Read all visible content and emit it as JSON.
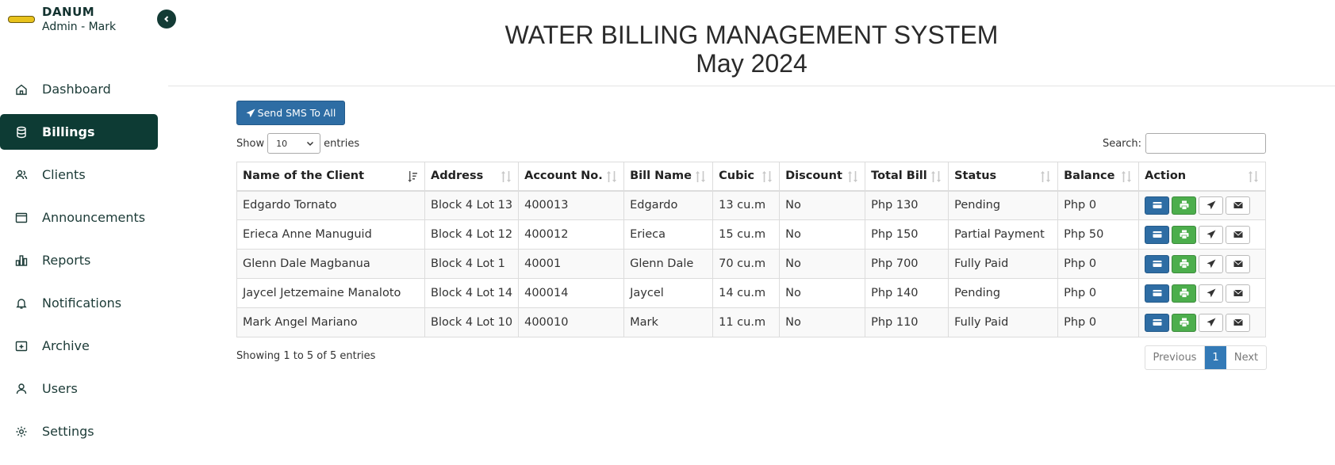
{
  "sidebar": {
    "brand": "DANUM",
    "user": "Admin - Mark",
    "items": [
      {
        "label": "Dashboard",
        "icon": "home-icon"
      },
      {
        "label": "Billings",
        "icon": "database-icon",
        "active": true
      },
      {
        "label": "Clients",
        "icon": "users-icon"
      },
      {
        "label": "Announcements",
        "icon": "window-icon"
      },
      {
        "label": "Reports",
        "icon": "bar-chart-icon"
      },
      {
        "label": "Notifications",
        "icon": "bell-icon"
      },
      {
        "label": "Archive",
        "icon": "archive-icon"
      },
      {
        "label": "Users",
        "icon": "user-icon"
      },
      {
        "label": "Settings",
        "icon": "gear-icon"
      }
    ]
  },
  "header": {
    "title": "WATER BILLING MANAGEMENT SYSTEM",
    "period": "May 2024"
  },
  "toolbar": {
    "sms_all_label": "Send SMS To All",
    "show_label": "Show",
    "entries_value": "10",
    "entries_label": "entries",
    "search_label": "Search:"
  },
  "table": {
    "columns": [
      "Name of the Client",
      "Address",
      "Account No.",
      "Bill Name",
      "Cubic",
      "Discount",
      "Total Bill",
      "Status",
      "Balance",
      "Action"
    ],
    "rows": [
      [
        "Edgardo Tornato",
        "Block 4 Lot 13",
        "400013",
        "Edgardo",
        "13 cu.m",
        "No",
        "Php 130",
        "Pending",
        "Php 0"
      ],
      [
        "Erieca Anne Manuguid",
        "Block 4 Lot 12",
        "400012",
        "Erieca",
        "15 cu.m",
        "No",
        "Php 150",
        "Partial Payment",
        "Php 50"
      ],
      [
        "Glenn Dale Magbanua",
        "Block 4 Lot 1",
        "40001",
        "Glenn Dale",
        "70 cu.m",
        "No",
        "Php 700",
        "Fully Paid",
        "Php 0"
      ],
      [
        "Jaycel Jetzemaine Manaloto",
        "Block 4 Lot 14",
        "400014",
        "Jaycel",
        "14 cu.m",
        "No",
        "Php 140",
        "Pending",
        "Php 0"
      ],
      [
        "Mark Angel Mariano",
        "Block 4 Lot 10",
        "400010",
        "Mark",
        "11 cu.m",
        "No",
        "Php 110",
        "Fully Paid",
        "Php 0"
      ]
    ]
  },
  "footer": {
    "info": "Showing 1 to 5 of 5 entries",
    "prev": "Previous",
    "page": "1",
    "next": "Next"
  },
  "colors": {
    "sidebar_active": "#0d3b34",
    "primary": "#2e6da4",
    "success": "#4cae4c"
  }
}
